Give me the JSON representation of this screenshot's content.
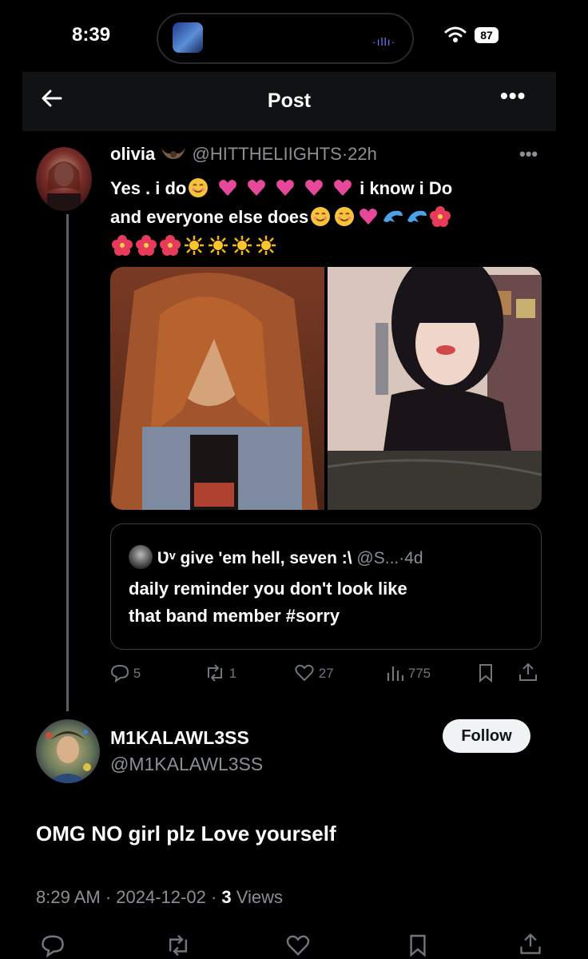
{
  "status_bar": {
    "time": "8:39",
    "battery": "87"
  },
  "header": {
    "title": "Post"
  },
  "parent_post": {
    "display_name": "olivia",
    "handle": "@HITTHELIIGHTS",
    "age": "22h",
    "text_line1_a": "Yes . i do",
    "text_line1_b": "i know i Do",
    "text_line2": "and everyone else does",
    "quote": {
      "author": "Ʋᵛ give 'em hell, seven :\\",
      "handle": "@S...",
      "age": "4d",
      "text_line1": "daily reminder you don't look like",
      "text_line2": "that band member #sorry"
    },
    "stats": {
      "replies": "5",
      "reposts": "1",
      "likes": "27",
      "views": "775"
    }
  },
  "reply_post": {
    "display_name": "M1KALAWL3SS",
    "handle": "@M1KALAWL3SS",
    "follow_label": "Follow",
    "text": "OMG NO girl plz Love yourself",
    "time": "8:29 AM",
    "date": "2024-12-02",
    "views_count": "3",
    "views_label": "Views"
  },
  "colors": {
    "background": "#000000",
    "muted": "#8b9096",
    "thread_line": "#5a5f66",
    "follow_bg": "#eff3f4"
  }
}
